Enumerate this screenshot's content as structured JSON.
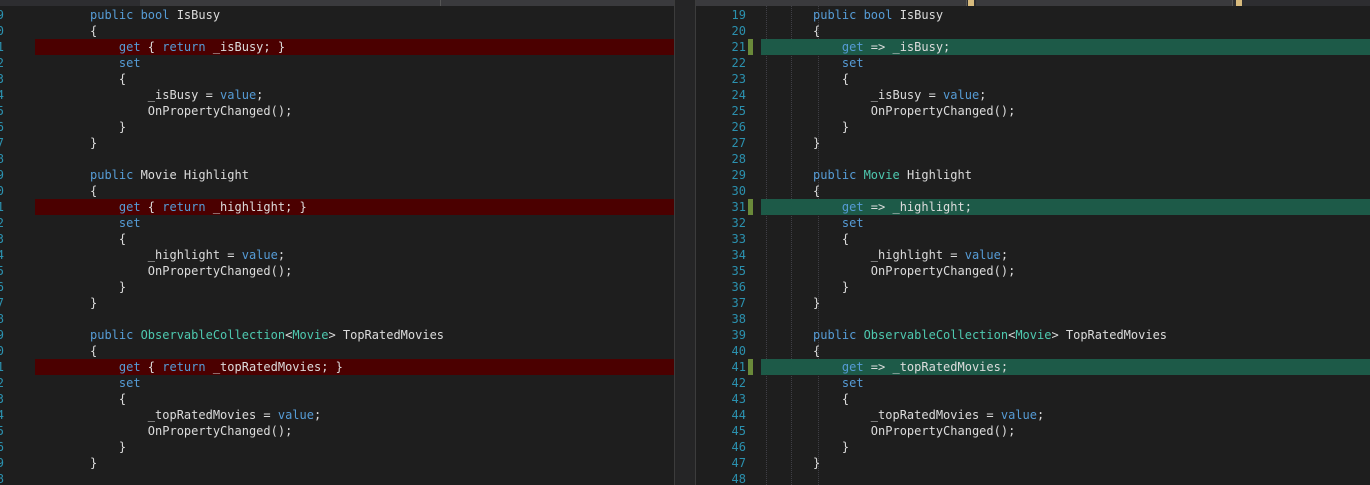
{
  "left": {
    "lines": [
      {
        "n": "9",
        "segs": [
          {
            "t": "public ",
            "c": "kw"
          },
          {
            "t": "bool ",
            "c": "kw"
          },
          {
            "t": "IsBusy",
            "c": "pl"
          }
        ]
      },
      {
        "n": "0",
        "segs": [
          {
            "t": "{",
            "c": "pl"
          }
        ]
      },
      {
        "n": "1",
        "removed": true,
        "segs": [
          {
            "t": "    get ",
            "c": "kw"
          },
          {
            "t": "{ ",
            "c": "pl"
          },
          {
            "t": "return ",
            "c": "kw"
          },
          {
            "t": "_isBusy; }",
            "c": "pl"
          }
        ]
      },
      {
        "n": "2",
        "segs": [
          {
            "t": "    set",
            "c": "kw"
          }
        ]
      },
      {
        "n": "3",
        "segs": [
          {
            "t": "    {",
            "c": "pl"
          }
        ]
      },
      {
        "n": "4",
        "segs": [
          {
            "t": "        _isBusy = ",
            "c": "pl"
          },
          {
            "t": "value",
            "c": "kw"
          },
          {
            "t": ";",
            "c": "pl"
          }
        ]
      },
      {
        "n": "5",
        "segs": [
          {
            "t": "        OnPropertyChanged();",
            "c": "pl"
          }
        ]
      },
      {
        "n": "6",
        "segs": [
          {
            "t": "    }",
            "c": "pl"
          }
        ]
      },
      {
        "n": "7",
        "segs": [
          {
            "t": "}",
            "c": "pl"
          }
        ]
      },
      {
        "n": "8",
        "segs": []
      },
      {
        "n": "9",
        "segs": [
          {
            "t": "public ",
            "c": "kw"
          },
          {
            "t": "Movie Highlight",
            "c": "pl"
          }
        ]
      },
      {
        "n": "0",
        "segs": [
          {
            "t": "{",
            "c": "pl"
          }
        ]
      },
      {
        "n": "1",
        "removed": true,
        "segs": [
          {
            "t": "    get ",
            "c": "kw"
          },
          {
            "t": "{ ",
            "c": "pl"
          },
          {
            "t": "return ",
            "c": "kw"
          },
          {
            "t": "_highlight; }",
            "c": "pl"
          }
        ]
      },
      {
        "n": "2",
        "segs": [
          {
            "t": "    set",
            "c": "kw"
          }
        ]
      },
      {
        "n": "3",
        "segs": [
          {
            "t": "    {",
            "c": "pl"
          }
        ]
      },
      {
        "n": "4",
        "segs": [
          {
            "t": "        _highlight = ",
            "c": "pl"
          },
          {
            "t": "value",
            "c": "kw"
          },
          {
            "t": ";",
            "c": "pl"
          }
        ]
      },
      {
        "n": "5",
        "segs": [
          {
            "t": "        OnPropertyChanged();",
            "c": "pl"
          }
        ]
      },
      {
        "n": "6",
        "segs": [
          {
            "t": "    }",
            "c": "pl"
          }
        ]
      },
      {
        "n": "7",
        "segs": [
          {
            "t": "}",
            "c": "pl"
          }
        ]
      },
      {
        "n": "8",
        "segs": []
      },
      {
        "n": "9",
        "segs": [
          {
            "t": "public ",
            "c": "kw"
          },
          {
            "t": "ObservableCollection",
            "c": "ty"
          },
          {
            "t": "<",
            "c": "pl"
          },
          {
            "t": "Movie",
            "c": "ty"
          },
          {
            "t": "> TopRatedMovies",
            "c": "pl"
          }
        ]
      },
      {
        "n": "0",
        "segs": [
          {
            "t": "{",
            "c": "pl"
          }
        ]
      },
      {
        "n": "1",
        "removed": true,
        "segs": [
          {
            "t": "    get ",
            "c": "kw"
          },
          {
            "t": "{ ",
            "c": "pl"
          },
          {
            "t": "return ",
            "c": "kw"
          },
          {
            "t": "_topRatedMovies; }",
            "c": "pl"
          }
        ]
      },
      {
        "n": "2",
        "segs": [
          {
            "t": "    set",
            "c": "kw"
          }
        ]
      },
      {
        "n": "3",
        "segs": [
          {
            "t": "    {",
            "c": "pl"
          }
        ]
      },
      {
        "n": "4",
        "segs": [
          {
            "t": "        _topRatedMovies = ",
            "c": "pl"
          },
          {
            "t": "value",
            "c": "kw"
          },
          {
            "t": ";",
            "c": "pl"
          }
        ]
      },
      {
        "n": "5",
        "segs": [
          {
            "t": "        OnPropertyChanged();",
            "c": "pl"
          }
        ]
      },
      {
        "n": "6",
        "segs": [
          {
            "t": "    }",
            "c": "pl"
          }
        ]
      },
      {
        "n": "9",
        "segs": [
          {
            "t": "}",
            "c": "pl"
          }
        ]
      },
      {
        "n": "8",
        "segs": []
      }
    ]
  },
  "right": {
    "lines": [
      {
        "n": "19",
        "segs": [
          {
            "t": "public ",
            "c": "kw"
          },
          {
            "t": "bool ",
            "c": "kw"
          },
          {
            "t": "IsBusy",
            "c": "pl"
          }
        ]
      },
      {
        "n": "20",
        "segs": [
          {
            "t": "{",
            "c": "pl"
          }
        ]
      },
      {
        "n": "21",
        "added": true,
        "segs": [
          {
            "t": "    get ",
            "c": "kw"
          },
          {
            "t": "=> _isBusy;",
            "c": "pl"
          }
        ]
      },
      {
        "n": "22",
        "segs": [
          {
            "t": "    set",
            "c": "kw"
          }
        ]
      },
      {
        "n": "23",
        "segs": [
          {
            "t": "    {",
            "c": "pl"
          }
        ]
      },
      {
        "n": "24",
        "segs": [
          {
            "t": "        _isBusy = ",
            "c": "pl"
          },
          {
            "t": "value",
            "c": "kw"
          },
          {
            "t": ";",
            "c": "pl"
          }
        ]
      },
      {
        "n": "25",
        "segs": [
          {
            "t": "        OnPropertyChanged();",
            "c": "pl"
          }
        ]
      },
      {
        "n": "26",
        "segs": [
          {
            "t": "    }",
            "c": "pl"
          }
        ]
      },
      {
        "n": "27",
        "segs": [
          {
            "t": "}",
            "c": "pl"
          }
        ]
      },
      {
        "n": "28",
        "segs": []
      },
      {
        "n": "29",
        "segs": [
          {
            "t": "public ",
            "c": "kw"
          },
          {
            "t": "Movie ",
            "c": "ty"
          },
          {
            "t": "Highlight",
            "c": "pl"
          }
        ]
      },
      {
        "n": "30",
        "segs": [
          {
            "t": "{",
            "c": "pl"
          }
        ]
      },
      {
        "n": "31",
        "added": true,
        "segs": [
          {
            "t": "    get ",
            "c": "kw"
          },
          {
            "t": "=> _highlight;",
            "c": "pl"
          }
        ]
      },
      {
        "n": "32",
        "segs": [
          {
            "t": "    set",
            "c": "kw"
          }
        ]
      },
      {
        "n": "33",
        "segs": [
          {
            "t": "    {",
            "c": "pl"
          }
        ]
      },
      {
        "n": "34",
        "segs": [
          {
            "t": "        _highlight = ",
            "c": "pl"
          },
          {
            "t": "value",
            "c": "kw"
          },
          {
            "t": ";",
            "c": "pl"
          }
        ]
      },
      {
        "n": "35",
        "segs": [
          {
            "t": "        OnPropertyChanged();",
            "c": "pl"
          }
        ]
      },
      {
        "n": "36",
        "segs": [
          {
            "t": "    }",
            "c": "pl"
          }
        ]
      },
      {
        "n": "37",
        "segs": [
          {
            "t": "}",
            "c": "pl"
          }
        ]
      },
      {
        "n": "38",
        "segs": []
      },
      {
        "n": "39",
        "segs": [
          {
            "t": "public ",
            "c": "kw"
          },
          {
            "t": "ObservableCollection",
            "c": "ty"
          },
          {
            "t": "<",
            "c": "pl"
          },
          {
            "t": "Movie",
            "c": "ty"
          },
          {
            "t": "> TopRatedMovies",
            "c": "pl"
          }
        ]
      },
      {
        "n": "40",
        "segs": [
          {
            "t": "{",
            "c": "pl"
          }
        ]
      },
      {
        "n": "41",
        "added": true,
        "segs": [
          {
            "t": "    get ",
            "c": "kw"
          },
          {
            "t": "=> _topRatedMovies;",
            "c": "pl"
          }
        ]
      },
      {
        "n": "42",
        "segs": [
          {
            "t": "    set",
            "c": "kw"
          }
        ]
      },
      {
        "n": "43",
        "segs": [
          {
            "t": "    {",
            "c": "pl"
          }
        ]
      },
      {
        "n": "44",
        "segs": [
          {
            "t": "        _topRatedMovies = ",
            "c": "pl"
          },
          {
            "t": "value",
            "c": "kw"
          },
          {
            "t": ";",
            "c": "pl"
          }
        ]
      },
      {
        "n": "45",
        "segs": [
          {
            "t": "        OnPropertyChanged();",
            "c": "pl"
          }
        ]
      },
      {
        "n": "46",
        "segs": [
          {
            "t": "    }",
            "c": "pl"
          }
        ]
      },
      {
        "n": "47",
        "segs": [
          {
            "t": "}",
            "c": "pl"
          }
        ]
      },
      {
        "n": "48",
        "segs": []
      }
    ]
  },
  "colors": {
    "removed_bg": "#4b0000",
    "added_bg": "#1d5a48",
    "change_bar": "#6a8a3a",
    "keyword": "#569cd6",
    "type": "#4ec9b0",
    "line_number": "#2b91af"
  }
}
